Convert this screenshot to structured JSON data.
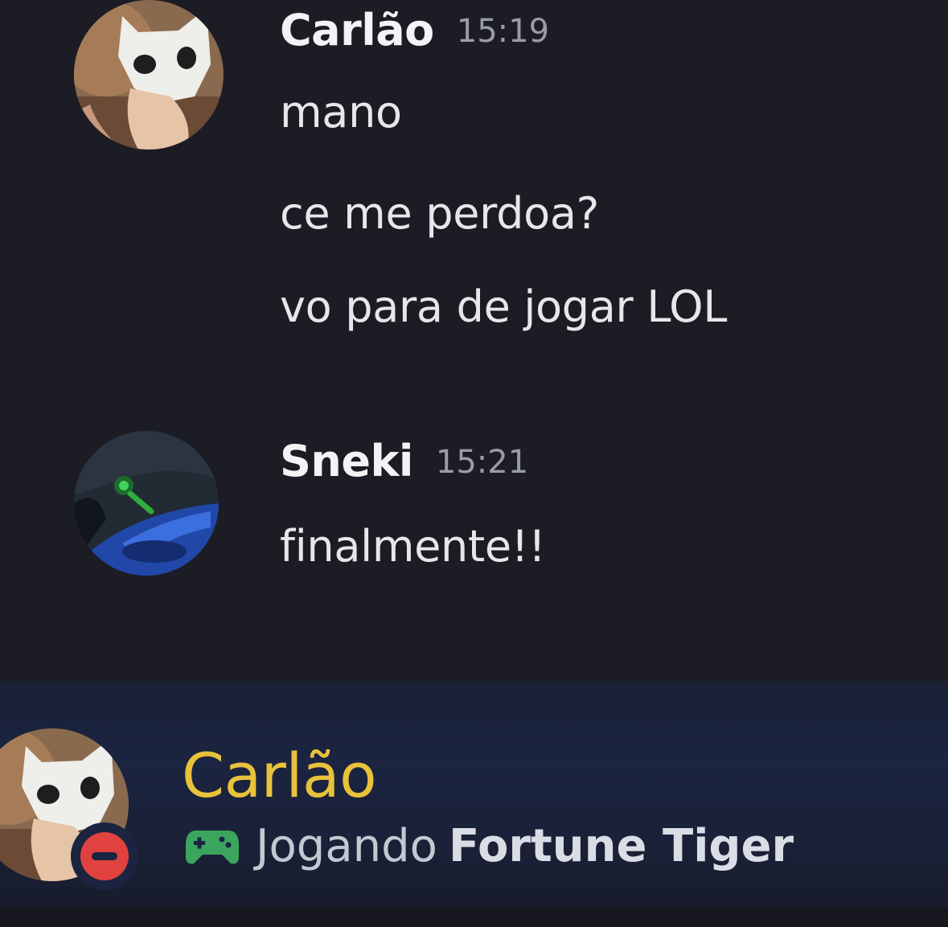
{
  "messages": [
    {
      "author": "Carlão",
      "time": "15:19",
      "lines": [
        "mano",
        "ce me perdoa?",
        "vo para de jogar LOL"
      ]
    },
    {
      "author": "Sneki",
      "time": "15:21",
      "lines": [
        "finalmente!!"
      ]
    }
  ],
  "profile": {
    "name": "Carlão",
    "activity_prefix": "Jogando",
    "activity_game": "Fortune Tiger",
    "status": "do-not-disturb",
    "name_color": "#e8c23b",
    "status_color": "#e0423f",
    "gamepad_color": "#3ba55d"
  }
}
